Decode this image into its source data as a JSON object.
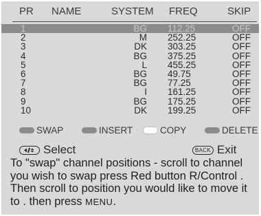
{
  "columns": {
    "pr": "PR",
    "name": "NAME",
    "system": "SYSTEM",
    "freq": "FREQ",
    "skip": "SKIP"
  },
  "channels": [
    {
      "pr": "1",
      "system": "BG",
      "freq": "112.25",
      "skip": "OFF",
      "selected": true
    },
    {
      "pr": "2",
      "system": "M",
      "freq": "252.25",
      "skip": "OFF"
    },
    {
      "pr": "3",
      "system": "DK",
      "freq": "303.25",
      "skip": "OFF"
    },
    {
      "pr": "4",
      "system": "BG",
      "freq": "375.25",
      "skip": "OFF"
    },
    {
      "pr": "5",
      "system": "L",
      "freq": "455.25",
      "skip": "OFF"
    },
    {
      "pr": "6",
      "system": "BG",
      "freq": "49.75",
      "skip": "OFF"
    },
    {
      "pr": "7",
      "system": "BG",
      "freq": "77.25",
      "skip": "OFF"
    },
    {
      "pr": "8",
      "system": "I",
      "freq": "161.25",
      "skip": "OFF"
    },
    {
      "pr": "9",
      "system": "BG",
      "freq": "175.25",
      "skip": "OFF"
    },
    {
      "pr": "10",
      "system": "DK",
      "freq": "199.25",
      "skip": "OFF"
    }
  ],
  "legend": {
    "swap": {
      "label": "SWAP",
      "color": "#8c8c8c"
    },
    "insert": {
      "label": "INSERT",
      "color": "#8c8c8c"
    },
    "copy": {
      "label": "COPY",
      "color": "#ffffff"
    },
    "delete": {
      "label": "DELETE",
      "color": "#8c8c8c"
    }
  },
  "nav": {
    "select_label": "Select",
    "exit_label": "Exit",
    "back_key": "BACK"
  },
  "help": {
    "text_part1": "To \"swap\" channel positions - scroll to channel you wish to swap press Red button R/Control . Then scroll to position you would like to move it to . then press ",
    "menu_word": "MENU",
    "text_part2": "."
  }
}
